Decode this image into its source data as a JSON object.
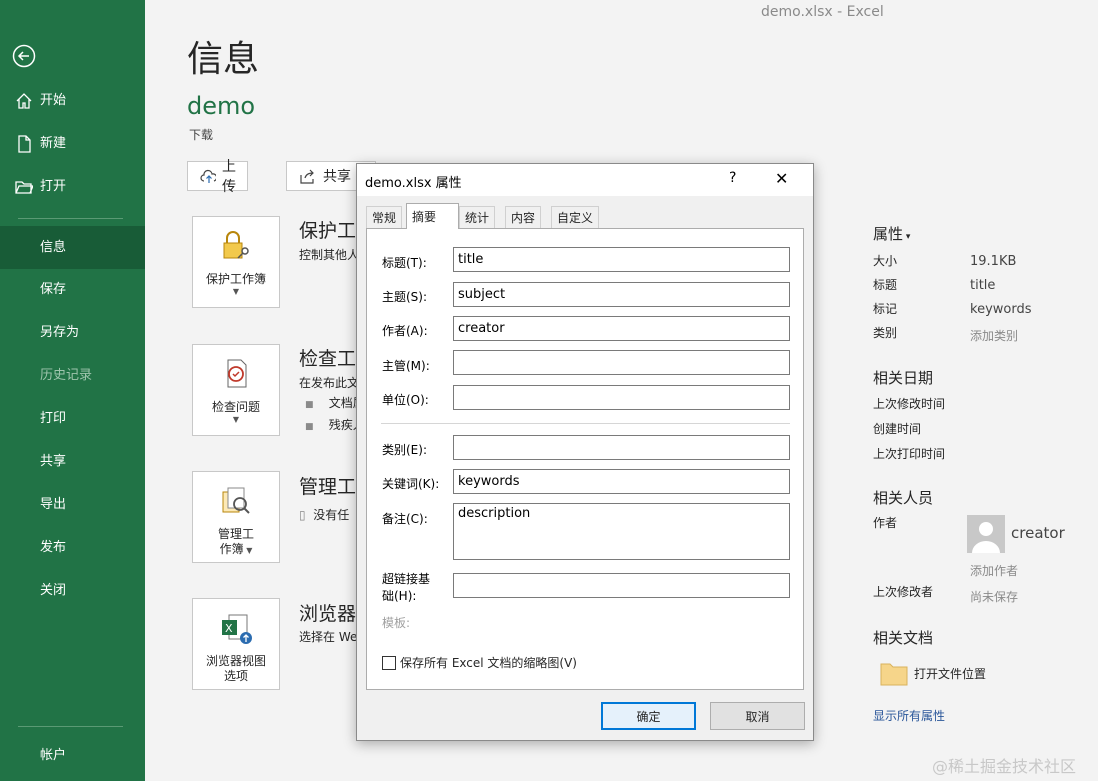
{
  "window": {
    "file": "demo.xlsx",
    "sep": "-",
    "app": "Excel"
  },
  "sidebar": {
    "items": [
      {
        "label": "开始"
      },
      {
        "label": "新建"
      },
      {
        "label": "打开"
      },
      {
        "label": "信息"
      },
      {
        "label": "保存"
      },
      {
        "label": "另存为"
      },
      {
        "label": "历史记录"
      },
      {
        "label": "打印"
      },
      {
        "label": "共享"
      },
      {
        "label": "导出"
      },
      {
        "label": "发布"
      },
      {
        "label": "关闭"
      },
      {
        "label": "帐户"
      }
    ]
  },
  "main": {
    "title": "信息",
    "doc_name": "demo",
    "doc_location": "下载",
    "upload_label": "上传",
    "share_label": "共享",
    "protect": {
      "card": "保护工作簿",
      "title": "保护工",
      "desc": "控制其他人"
    },
    "inspect": {
      "card": "检查问题",
      "title": "检查工",
      "desc": "在发布此文",
      "bullets": [
        "文档属",
        "残疾人"
      ]
    },
    "manage": {
      "card_line1": "管理工",
      "card_line2": "作簿",
      "title": "管理工",
      "desc": "没有任"
    },
    "browser": {
      "card_line1": "浏览器视图",
      "card_line2": "选项",
      "title": "浏览器",
      "desc": "选择在 We"
    }
  },
  "props": {
    "heading": "属性",
    "size_label": "大小",
    "size_value": "19.1KB",
    "title_label": "标题",
    "title_value": "title",
    "tags_label": "标记",
    "tags_value": "keywords",
    "category_label": "类别",
    "category_value": "添加类别",
    "dates_heading": "相关日期",
    "modified_label": "上次修改时间",
    "created_label": "创建时间",
    "printed_label": "上次打印时间",
    "people_heading": "相关人员",
    "author_label": "作者",
    "author_name": "creator",
    "add_author": "添加作者",
    "last_modified_by_label": "上次修改者",
    "last_modified_by_value": "尚未保存",
    "docs_heading": "相关文档",
    "open_location": "打开文件位置",
    "show_all": "显示所有属性"
  },
  "dialog": {
    "title": "demo.xlsx 属性",
    "help": "?",
    "tabs": [
      "常规",
      "摘要",
      "统计",
      "内容",
      "自定义"
    ],
    "fields": {
      "title_label": "标题(T):",
      "title_value": "title",
      "subject_label": "主题(S):",
      "subject_value": "subject",
      "author_label": "作者(A):",
      "author_value": "creator",
      "manager_label": "主管(M):",
      "manager_value": "",
      "company_label": "单位(O):",
      "company_value": "",
      "category_label": "类别(E):",
      "category_value": "",
      "keywords_label": "关键词(K):",
      "keywords_value": "keywords",
      "comments_label": "备注(C):",
      "comments_value": "description",
      "hyperlink_label_1": "超链接基",
      "hyperlink_label_2": "础(H):",
      "hyperlink_value": "",
      "template_label": "模板:"
    },
    "checkbox_label": "保存所有 Excel 文档的缩略图(V)",
    "ok": "确定",
    "cancel": "取消"
  },
  "watermark": "@稀土掘金技术社区"
}
